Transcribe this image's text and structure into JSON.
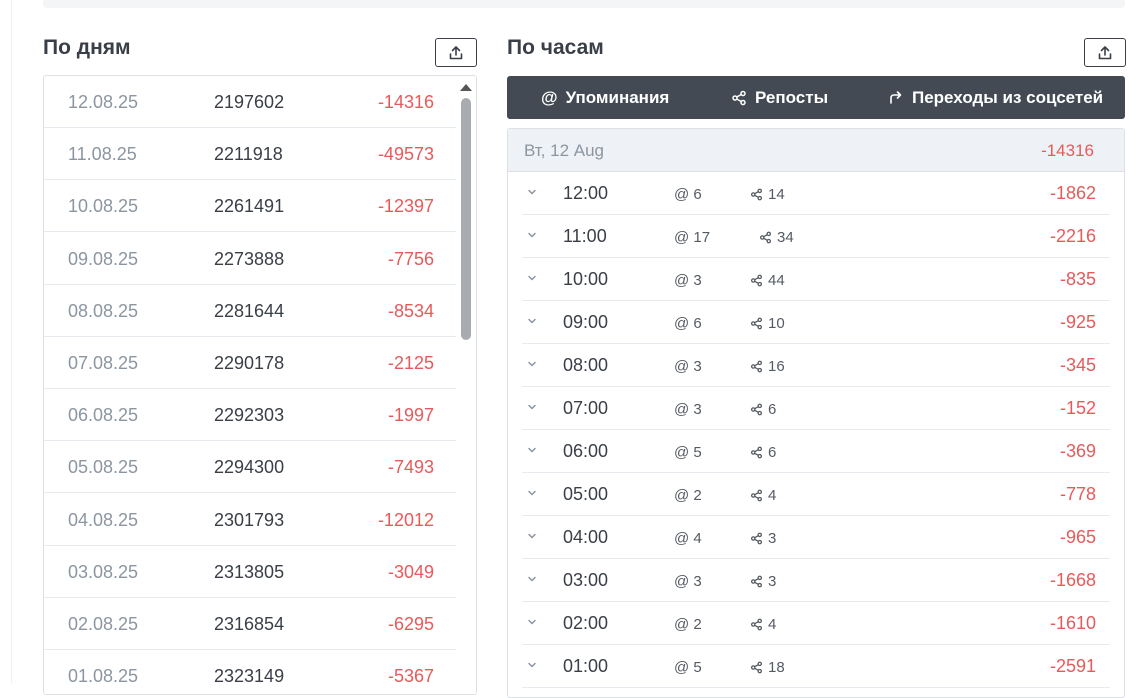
{
  "colors": {
    "negative": "#e85a5a",
    "tabs_bg": "#434a54",
    "muted": "#8c96a1"
  },
  "days_panel": {
    "title": "По дням",
    "export_icon": "upload-icon",
    "rows": [
      {
        "date": "12.08.25",
        "value": "2197602",
        "delta": "-14316"
      },
      {
        "date": "11.08.25",
        "value": "2211918",
        "delta": "-49573"
      },
      {
        "date": "10.08.25",
        "value": "2261491",
        "delta": "-12397"
      },
      {
        "date": "09.08.25",
        "value": "2273888",
        "delta": "-7756"
      },
      {
        "date": "08.08.25",
        "value": "2281644",
        "delta": "-8534"
      },
      {
        "date": "07.08.25",
        "value": "2290178",
        "delta": "-2125"
      },
      {
        "date": "06.08.25",
        "value": "2292303",
        "delta": "-1997"
      },
      {
        "date": "05.08.25",
        "value": "2294300",
        "delta": "-7493"
      },
      {
        "date": "04.08.25",
        "value": "2301793",
        "delta": "-12012"
      },
      {
        "date": "03.08.25",
        "value": "2313805",
        "delta": "-3049"
      },
      {
        "date": "02.08.25",
        "value": "2316854",
        "delta": "-6295"
      },
      {
        "date": "01.08.25",
        "value": "2323149",
        "delta": "-5367"
      }
    ]
  },
  "hours_panel": {
    "title": "По часам",
    "export_icon": "upload-icon",
    "tabs": [
      {
        "label": "Упоминания",
        "icon": "at-icon"
      },
      {
        "label": "Репосты",
        "icon": "share-icon"
      },
      {
        "label": "Переходы из соцсетей",
        "icon": "redirect-arrow-icon"
      }
    ],
    "date_label": "Вт, 12 Aug",
    "date_total": "-14316",
    "rows": [
      {
        "time": "12:00",
        "mentions": "6",
        "reposts": "14",
        "delta": "-1862"
      },
      {
        "time": "11:00",
        "mentions": "17",
        "reposts": "34",
        "delta": "-2216"
      },
      {
        "time": "10:00",
        "mentions": "3",
        "reposts": "44",
        "delta": "-835"
      },
      {
        "time": "09:00",
        "mentions": "6",
        "reposts": "10",
        "delta": "-925"
      },
      {
        "time": "08:00",
        "mentions": "3",
        "reposts": "16",
        "delta": "-345"
      },
      {
        "time": "07:00",
        "mentions": "3",
        "reposts": "6",
        "delta": "-152"
      },
      {
        "time": "06:00",
        "mentions": "5",
        "reposts": "6",
        "delta": "-369"
      },
      {
        "time": "05:00",
        "mentions": "2",
        "reposts": "4",
        "delta": "-778"
      },
      {
        "time": "04:00",
        "mentions": "4",
        "reposts": "3",
        "delta": "-965"
      },
      {
        "time": "03:00",
        "mentions": "3",
        "reposts": "3",
        "delta": "-1668"
      },
      {
        "time": "02:00",
        "mentions": "2",
        "reposts": "4",
        "delta": "-1610"
      },
      {
        "time": "01:00",
        "mentions": "5",
        "reposts": "18",
        "delta": "-2591"
      }
    ]
  }
}
